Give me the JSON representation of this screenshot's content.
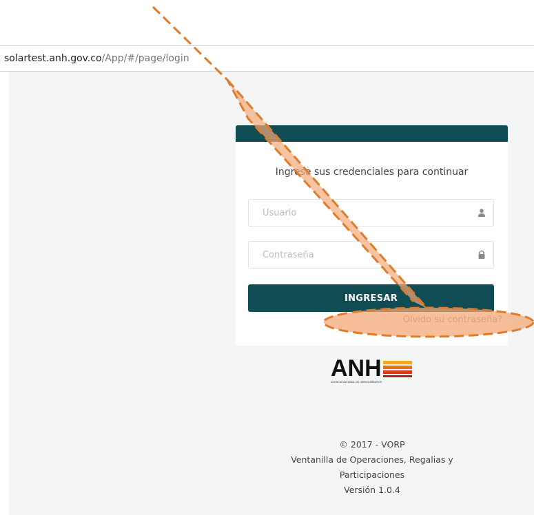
{
  "browser": {
    "url_host": "solartest.anh.gov.co",
    "url_path": "/App/#/page/login"
  },
  "login": {
    "prompt": "Ingrese sus credenciales para continuar",
    "username_placeholder": "Usuario",
    "password_placeholder": "Contraseña",
    "submit_label": "INGRESAR",
    "forgot_link": "Olvido su contraseña?"
  },
  "logo": {
    "text": "ANH",
    "subtext": "AGENCIA NACIONAL DE HIDROCARBUROS"
  },
  "footer": {
    "copyright": "© 2017 - VORP",
    "line1": "Ventanilla de Operaciones, Regalias y",
    "line2": "Participaciones",
    "version": "Versión 1.0.4"
  },
  "colors": {
    "primary": "#0f4c54",
    "annotation_stroke": "#e07b2a",
    "annotation_fill": "#f3a978"
  },
  "icons": {
    "username": "user-icon",
    "password": "lock-icon"
  }
}
